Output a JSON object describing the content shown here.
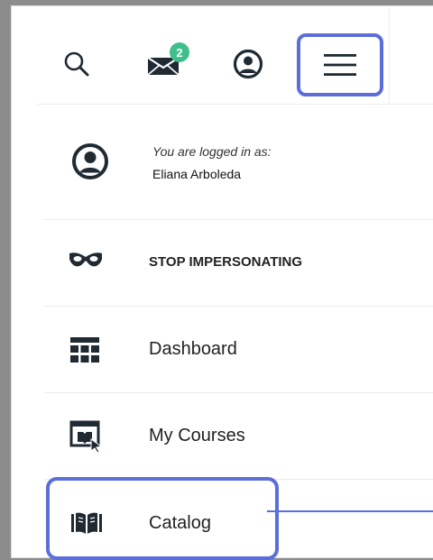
{
  "header": {
    "search_icon": "search-icon",
    "mail_icon": "envelope-icon",
    "mail_badge": "2",
    "profile_icon": "user-circle-icon",
    "menu_icon": "hamburger-menu-icon"
  },
  "user": {
    "caption": "You are logged in as:",
    "name": "Eliana Arboleda",
    "icon": "user-circle-icon"
  },
  "menu": {
    "items": [
      {
        "label": "STOP IMPERSONATING",
        "icon": "mask-icon"
      },
      {
        "label": "Dashboard",
        "icon": "grid-icon"
      },
      {
        "label": "My Courses",
        "icon": "course-window-icon"
      },
      {
        "label": "Catalog",
        "icon": "book-icon"
      }
    ]
  },
  "colors": {
    "highlight": "#5b6ed9",
    "badge": "#3fbf8c",
    "icon": "#1f2a33",
    "divider": "#ececec"
  }
}
